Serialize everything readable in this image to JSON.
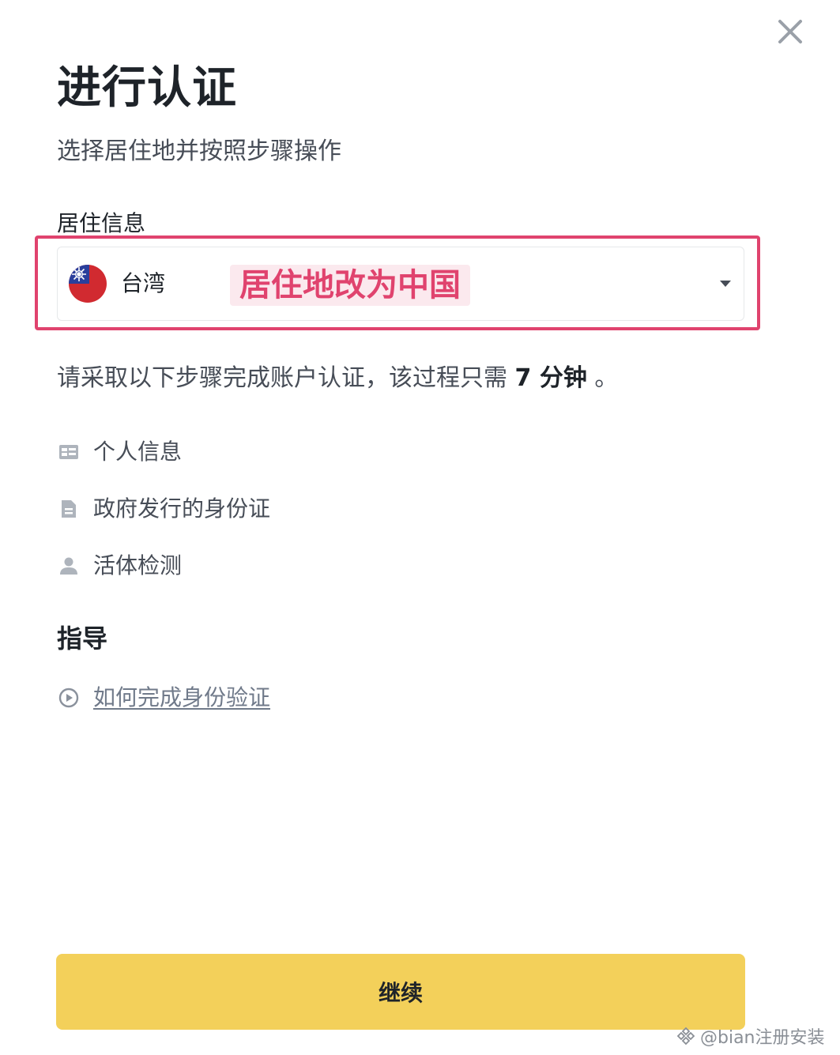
{
  "header": {
    "title": "进行认证",
    "subtitle": "选择居住地并按照步骤操作"
  },
  "residence": {
    "label": "居住信息",
    "selected": "台湾",
    "flag_icon": "taiwan-flag-icon",
    "annotation": "居住地改为中国",
    "annotation_color": "#e0436e"
  },
  "steps": {
    "intro_prefix": "请采取以下步骤完成账户认证，该过程只需",
    "intro_time": "7 分钟",
    "intro_suffix": "。",
    "items": [
      {
        "label": "个人信息",
        "icon": "id-card-icon"
      },
      {
        "label": "政府发行的身份证",
        "icon": "document-icon"
      },
      {
        "label": "活体检测",
        "icon": "person-icon"
      }
    ]
  },
  "guide": {
    "title": "指导",
    "link_label": "如何完成身份验证",
    "link_icon": "play-circle-icon"
  },
  "footer": {
    "continue_label": "继续",
    "button_color": "#f3d05a"
  },
  "watermark": {
    "text": "@bian注册安装"
  }
}
